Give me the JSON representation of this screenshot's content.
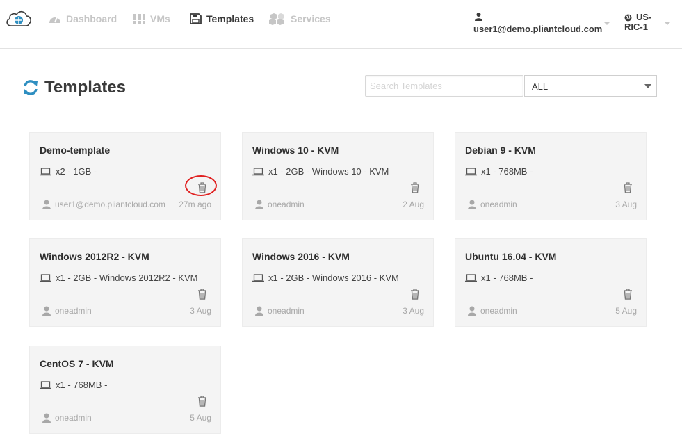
{
  "nav": {
    "items": [
      {
        "label": "Dashboard",
        "icon": "tachometer-icon"
      },
      {
        "label": "VMs",
        "icon": "grid-icon"
      },
      {
        "label": "Templates",
        "icon": "floppy-icon"
      },
      {
        "label": "Services",
        "icon": "cubes-icon"
      }
    ],
    "active": "Templates"
  },
  "user": {
    "email": "user1@demo.pliantcloud.com"
  },
  "region": {
    "line1": "US-",
    "line2": "RIC-1"
  },
  "page": {
    "title": "Templates",
    "search_placeholder": "Search Templates",
    "filter_value": "ALL"
  },
  "templates": [
    {
      "name": "Demo-template",
      "specs": "x2 - 1GB -",
      "owner": "user1@demo.pliantcloud.com",
      "time": "27m ago"
    },
    {
      "name": "Windows 10 - KVM",
      "specs": "x1 - 2GB - Windows 10 - KVM",
      "owner": "oneadmin",
      "time": "2 Aug"
    },
    {
      "name": "Debian 9 - KVM",
      "specs": "x1 - 768MB -",
      "owner": "oneadmin",
      "time": "3 Aug"
    },
    {
      "name": "Windows 2012R2 - KVM",
      "specs": "x1 - 2GB - Windows 2012R2 - KVM",
      "owner": "oneadmin",
      "time": "3 Aug"
    },
    {
      "name": "Windows 2016 - KVM",
      "specs": "x1 - 2GB - Windows 2016 - KVM",
      "owner": "oneadmin",
      "time": "3 Aug"
    },
    {
      "name": "Ubuntu 16.04 - KVM",
      "specs": "x1 - 768MB -",
      "owner": "oneadmin",
      "time": "5 Aug"
    },
    {
      "name": "CentOS 7 - KVM",
      "specs": "x1 - 768MB -",
      "owner": "oneadmin",
      "time": "5 Aug"
    }
  ],
  "colors": {
    "accent": "#2f8fc1",
    "highlight": "#e02020",
    "card_bg": "#f4f4f4"
  }
}
